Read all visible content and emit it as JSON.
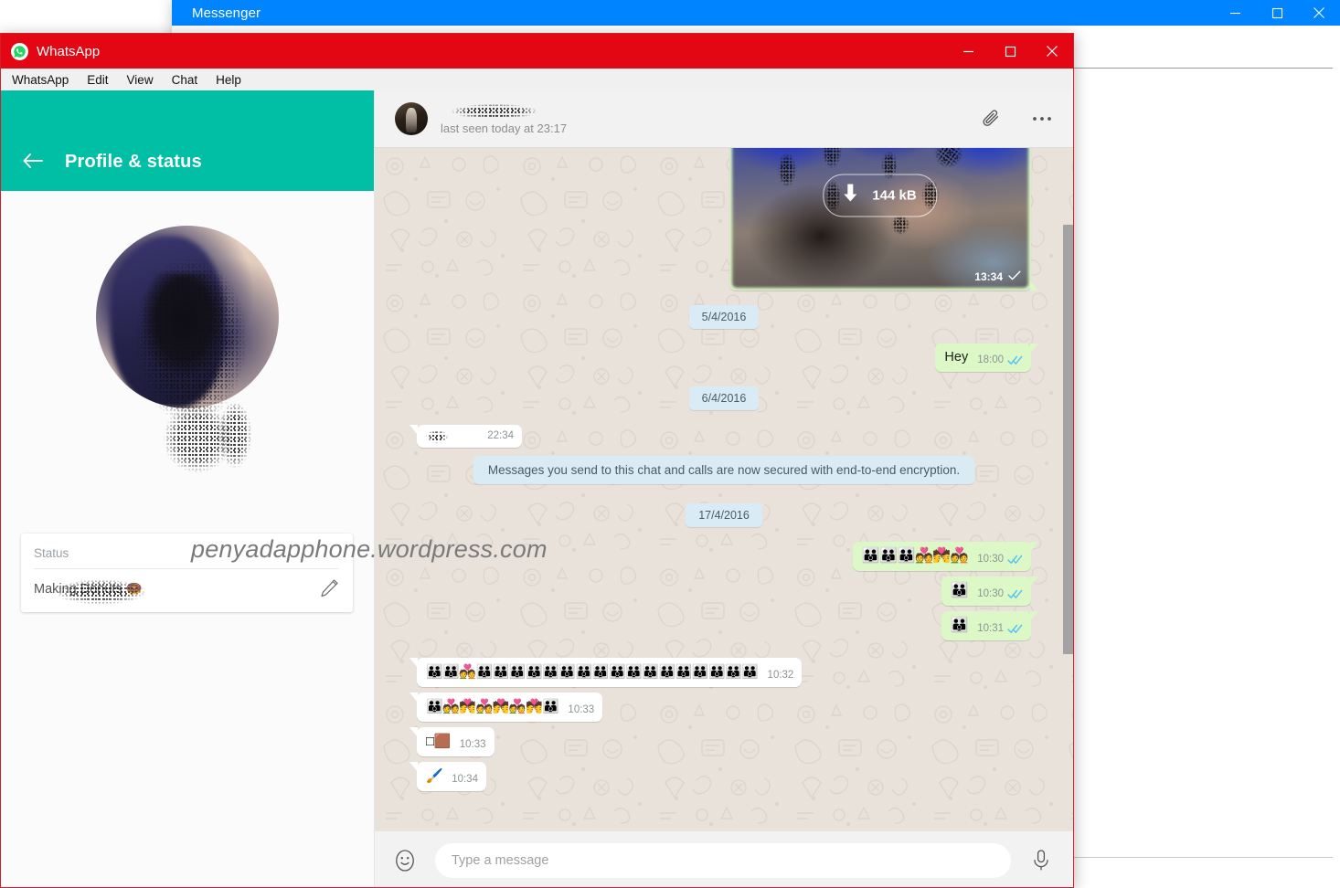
{
  "messenger": {
    "title": "Messenger",
    "controls": {
      "minimize": "minimize-icon",
      "maximize": "maximize-icon",
      "close": "close-icon"
    }
  },
  "whatsapp": {
    "title": "WhatsApp",
    "logo_icon": "whatsapp-logo-icon",
    "controls": {
      "minimize": "minimize-icon",
      "maximize": "maximize-icon",
      "close": "close-icon"
    },
    "menubar": [
      {
        "label": "WhatsApp"
      },
      {
        "label": "Edit"
      },
      {
        "label": "View"
      },
      {
        "label": "Chat"
      },
      {
        "label": "Help"
      }
    ]
  },
  "profile_panel": {
    "header_title": "Profile & status",
    "back_icon": "back-arrow-icon",
    "avatar_alt": "profile-photo-censored",
    "status_label": "Status",
    "status_value": "Making Donuts 🍩",
    "edit_icon": "pencil-edit-icon"
  },
  "watermark": "penyadapphone.wordpress.com",
  "chat": {
    "header": {
      "contact_name": "",
      "subtitle": "last seen today at 23:17",
      "attach_icon": "paperclip-icon",
      "menu_icon": "more-options-icon"
    },
    "image_message": {
      "download_size": "144 kB",
      "download_icon": "download-arrow-icon",
      "timestamp": "13:34",
      "status": "sent-single-check"
    },
    "items": [
      {
        "type": "date",
        "text": "5/4/2016"
      },
      {
        "type": "out",
        "text": "Hey",
        "timestamp": "18:00",
        "status": "read-double-check"
      },
      {
        "type": "date",
        "text": "6/4/2016"
      },
      {
        "type": "in",
        "text": "",
        "censored": true,
        "timestamp": "22:34"
      },
      {
        "type": "system",
        "text": "Messages you send to this chat and calls are now secured with end-to-end encryption."
      },
      {
        "type": "date",
        "text": "17/4/2016"
      },
      {
        "type": "out",
        "text": "👪👪👪💑💏💑",
        "timestamp": "10:30",
        "status": "read-double-check"
      },
      {
        "type": "out",
        "text": "👪",
        "timestamp": "10:30",
        "status": "read-double-check"
      },
      {
        "type": "out",
        "text": "👪",
        "timestamp": "10:31",
        "status": "read-double-check"
      },
      {
        "type": "in",
        "text": "👪👪💑👪👪👪👪👪👪👪👪👪👪👪👪👪👪👪👪👪",
        "timestamp": "10:32"
      },
      {
        "type": "in",
        "text": "👪💑💏💑💏💑💏👪",
        "timestamp": "10:33"
      },
      {
        "type": "in",
        "text": "□🟫",
        "timestamp": "10:33"
      },
      {
        "type": "in",
        "text": "🖌️",
        "timestamp": "10:34"
      }
    ]
  },
  "composer": {
    "emoji_icon": "emoji-smiley-icon",
    "placeholder": "Type a message",
    "value": "",
    "mic_icon": "microphone-icon"
  },
  "colors": {
    "messenger_blue": "#0084ff",
    "whatsapp_red": "#e30613",
    "teal_header": "#00bfa5",
    "out_bubble": "#dcf8c6",
    "in_bubble": "#ffffff",
    "chip_blue": "#d9ecf5",
    "tick_blue": "#4fc3f7",
    "chat_bg": "#e9e2db"
  }
}
